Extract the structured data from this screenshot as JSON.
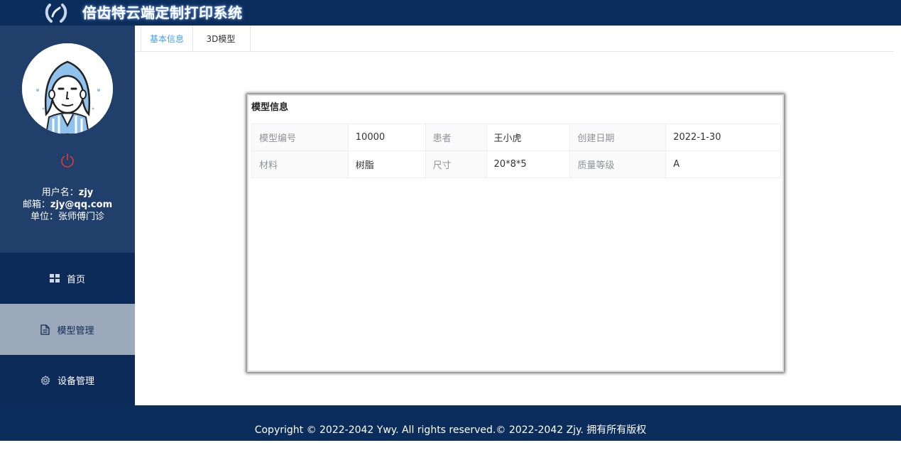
{
  "app": {
    "title": "倍齿特云端定制打印系统"
  },
  "user": {
    "username_label": "用户名：",
    "username": "zjy",
    "email_label": "邮箱：",
    "email": "zjy@qq.com",
    "unit_label": "单位：",
    "unit": "张师傅门诊"
  },
  "sidebar": {
    "items": [
      {
        "label": "首页",
        "icon": "grid-icon",
        "active": false
      },
      {
        "label": "模型管理",
        "icon": "document-icon",
        "active": true
      },
      {
        "label": "设备管理",
        "icon": "gear-icon",
        "active": false
      }
    ]
  },
  "tabs": [
    {
      "label": "基本信息",
      "active": true
    },
    {
      "label": "3D模型",
      "active": false
    }
  ],
  "card": {
    "title": "模型信息",
    "rows": [
      [
        {
          "label": "模型编号",
          "value": "10000"
        },
        {
          "label": "患者",
          "value": "王小虎"
        },
        {
          "label": "创建日期",
          "value": "2022-1-30"
        }
      ],
      [
        {
          "label": "材料",
          "value": "树脂"
        },
        {
          "label": "尺寸",
          "value": "20*8*5"
        },
        {
          "label": "质量等级",
          "value": "A"
        }
      ]
    ]
  },
  "footer": {
    "text": "Copyright © 2022-2042 Ywy. All rights reserved.© 2022-2042 Zjy. 拥有所有版权"
  },
  "colors": {
    "header": "#0b2d5b",
    "sidebar": "#1d3a66",
    "active_nav": "#9ba9bb",
    "tab_active": "#409eff",
    "power": "#e53935"
  }
}
